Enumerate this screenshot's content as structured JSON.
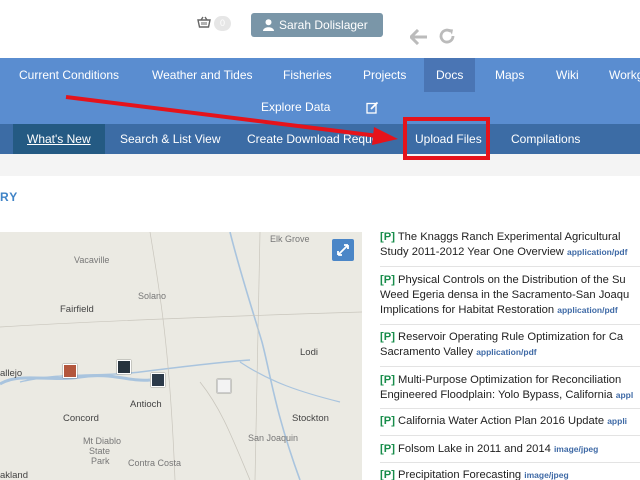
{
  "header": {
    "basket_count": "0",
    "user_name": "Sarah Dolislager"
  },
  "main_nav": {
    "items": [
      {
        "label": "Current Conditions"
      },
      {
        "label": "Weather and Tides"
      },
      {
        "label": "Fisheries"
      },
      {
        "label": "Projects"
      },
      {
        "label": "Docs"
      },
      {
        "label": "Maps"
      },
      {
        "label": "Wiki"
      },
      {
        "label": "Workg"
      }
    ],
    "explore_label": "Explore Data"
  },
  "sub_nav": {
    "items": [
      {
        "label": "What's New"
      },
      {
        "label": "Search & List View"
      },
      {
        "label": "Create Download Reque"
      },
      {
        "label": "Upload Files"
      },
      {
        "label": "Compilations"
      }
    ]
  },
  "section": {
    "title": "RY"
  },
  "map": {
    "labels": [
      "Elk Grove",
      "Vacaville",
      "Solano",
      "Fairfield",
      "Lodi",
      "allejo",
      "Antioch",
      "Concord",
      "Stockton",
      "San Joaquin",
      "Mt Diablo",
      "State",
      "Park",
      "Contra Costa",
      "akland"
    ]
  },
  "documents": [
    {
      "tag": "[P]",
      "lines": [
        "The Knaggs Ranch Experimental Agricultural",
        "Study 2011-2012 Year One Overview"
      ],
      "mime": "application/pdf"
    },
    {
      "tag": "[P]",
      "lines": [
        "Physical Controls on the Distribution of the Su",
        "Weed Egeria densa in the Sacramento-San Joaqu",
        "Implications for Habitat Restoration"
      ],
      "mime": "application/pdf"
    },
    {
      "tag": "[P]",
      "lines": [
        "Reservoir Operating Rule Optimization for Ca",
        "Sacramento Valley"
      ],
      "mime": "application/pdf"
    },
    {
      "tag": "[P]",
      "lines": [
        "Multi-Purpose Optimization for Reconciliation",
        "Engineered Floodplain: Yolo Bypass, California"
      ],
      "mime": "appl"
    },
    {
      "tag": "[P]",
      "lines": [
        "California Water Action Plan 2016 Update"
      ],
      "mime": "appli"
    },
    {
      "tag": "[P]",
      "lines": [
        "Folsom Lake in 2011 and 2014"
      ],
      "mime": "image/jpeg"
    },
    {
      "tag": "[P]",
      "lines": [
        "Precipitation Forecasting"
      ],
      "mime": "image/jpeg"
    }
  ],
  "colors": {
    "main_nav": "#5a8dd0",
    "sub_nav": "#3c6ca5",
    "active_tab": "#245a83",
    "annotation": "#e5131b",
    "tag": "#178c4a"
  }
}
